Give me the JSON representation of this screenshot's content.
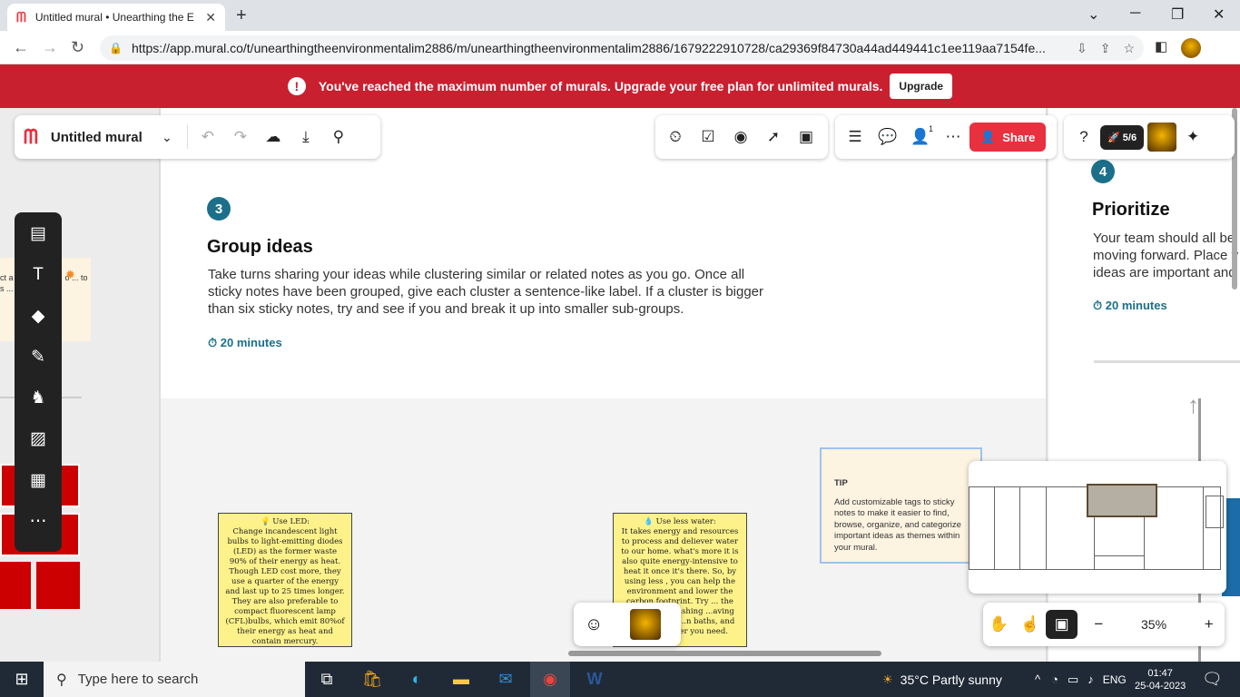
{
  "browser": {
    "tab_title": "Untitled mural • Unearthing the E",
    "url": "https://app.mural.co/t/unearthingtheenvironmentalim2886/m/unearthingtheenvironmentalim2886/1679222910728/ca29369f84730a44ad449441c1ee119aa7154fe...",
    "new_tab": "+",
    "tab_close": "✕",
    "minimize": "─",
    "restore": "❐",
    "close": "✕",
    "back": "←",
    "forward": "→",
    "reload": "↻",
    "lock": "🔒"
  },
  "banner": {
    "message": "You've reached the maximum number of murals. Upgrade your free plan for unlimited murals.",
    "button": "Upgrade",
    "icon": "!"
  },
  "topbar": {
    "mural_title": "Untitled mural",
    "share_label": "Share",
    "progress": "5/6",
    "member_count": "1"
  },
  "section3": {
    "number": "3",
    "title": "Group ideas",
    "description": "Take turns sharing your ideas while clustering similar or related notes as you go. Once all sticky notes have been grouped, give each cluster a sentence-like label. If a cluster is bigger than six sticky notes, try and see if you and break it up into smaller sub-groups.",
    "timer": "20 minutes"
  },
  "section4": {
    "number": "4",
    "title": "Prioritize",
    "description": "Your team should all be moving forward. Place y ideas are important and",
    "timer": "20 minutes"
  },
  "stickies": [
    {
      "heading": "Use LED:",
      "body": "Change incandescent light bulbs to light-emitting diodes (LED) as the former waste 90% of their energy as heat. Though LED cost more, they use a quarter of the energy and last up to 25 times longer. They are also preferable to compact fluorescent lamp (CFL)bulbs, which emit 80%of their energy as heat and contain mercury."
    },
    {
      "heading": "Use less water:",
      "body": "It takes energy and resources to process and deliever water to our home. what's more it is also quite energy-intensive to heat it once it's there. So, by using less , you can help the environment and lower the carbon footprint. Try ... the taps when brushing ...aving short shower ...n baths, and only ...e water you need."
    }
  ],
  "left_partial_note": "ct a ... e ... enc ... o ... to s ... g!",
  "tip": {
    "label": "TIP",
    "body": "Add customizable tags to sticky notes to make it easier to find, browse, organize, and categorize important ideas as themes within your mural."
  },
  "zoom": {
    "level": "35%",
    "minus": "−",
    "plus": "+"
  },
  "taskbar": {
    "search_placeholder": "Type here to search",
    "weather": "35°C  Partly sunny",
    "lang": "ENG",
    "time": "01:47",
    "date": "25-04-2023"
  },
  "colors": {
    "banner": "#c9202f",
    "accent": "#1b6f8a",
    "share": "#e8303f",
    "sticky": "#fdf28a"
  }
}
